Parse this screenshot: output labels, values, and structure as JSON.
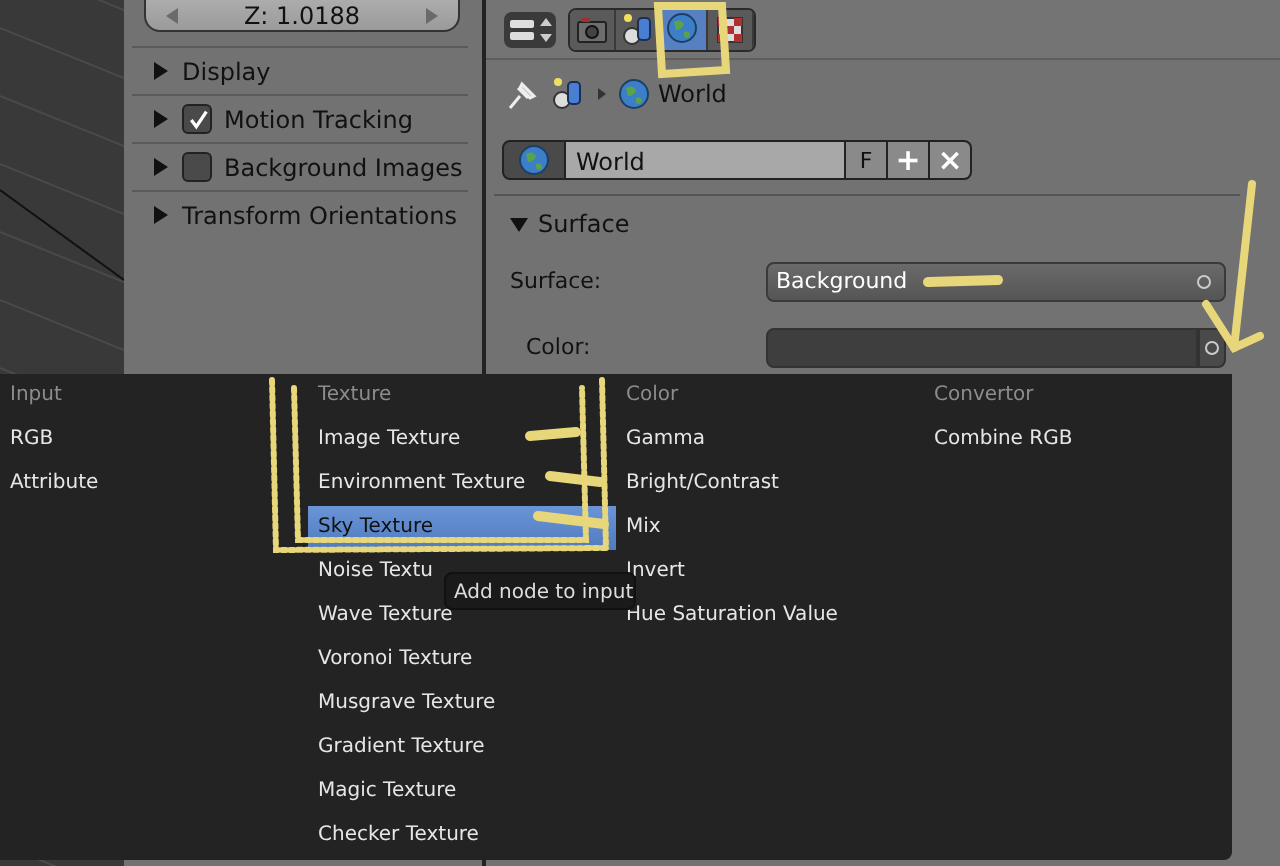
{
  "viewport_sidebar": {
    "z_field": "Z: 1.0188",
    "panels": [
      {
        "label": "Display",
        "kind": "plain",
        "expanded": false
      },
      {
        "label": "Motion Tracking",
        "kind": "checkbox",
        "checked": true,
        "expanded": false
      },
      {
        "label": "Background Images",
        "kind": "checkbox",
        "checked": false,
        "expanded": false
      },
      {
        "label": "Transform Orientations",
        "kind": "plain",
        "expanded": false
      }
    ]
  },
  "properties": {
    "context_tabs": [
      {
        "kind": "render",
        "selected": false
      },
      {
        "kind": "object",
        "selected": false
      },
      {
        "kind": "world",
        "selected": true
      },
      {
        "kind": "texture",
        "selected": false
      }
    ],
    "breadcrumb": {
      "label": "World"
    },
    "datablock": {
      "name": "World",
      "fake_user": "F",
      "add": "+",
      "remove": "×"
    },
    "panel": {
      "title": "Surface",
      "expanded": true,
      "fields": [
        {
          "kind": "dropdown",
          "label": "Surface:",
          "value": "Background"
        },
        {
          "kind": "color",
          "label": "Color:"
        }
      ]
    }
  },
  "node_menu": {
    "columns": [
      {
        "title": "Input",
        "items": [
          {
            "label": "RGB",
            "selected": false
          },
          {
            "label": "Attribute",
            "selected": false
          }
        ]
      },
      {
        "title": "Texture",
        "items": [
          {
            "label": "Image Texture",
            "selected": false
          },
          {
            "label": "Environment Texture",
            "selected": false
          },
          {
            "label": "Sky Texture",
            "selected": true
          },
          {
            "label": "Noise Textu",
            "selected": false
          },
          {
            "label": "Wave Texture",
            "selected": false
          },
          {
            "label": "Voronoi Texture",
            "selected": false
          },
          {
            "label": "Musgrave Texture",
            "selected": false
          },
          {
            "label": "Gradient Texture",
            "selected": false
          },
          {
            "label": "Magic Texture",
            "selected": false
          },
          {
            "label": "Checker Texture",
            "selected": false
          }
        ]
      },
      {
        "title": "Color",
        "items": [
          {
            "label": "Gamma",
            "selected": false
          },
          {
            "label": "Bright/Contrast",
            "selected": false
          },
          {
            "label": "Mix",
            "selected": false
          },
          {
            "label": "Invert",
            "selected": false
          },
          {
            "label": "Hue Saturation Value",
            "selected": false
          }
        ]
      },
      {
        "title": "Convertor",
        "items": [
          {
            "label": "Combine RGB",
            "selected": false
          }
        ]
      }
    ],
    "tooltip": "Add node to input"
  }
}
